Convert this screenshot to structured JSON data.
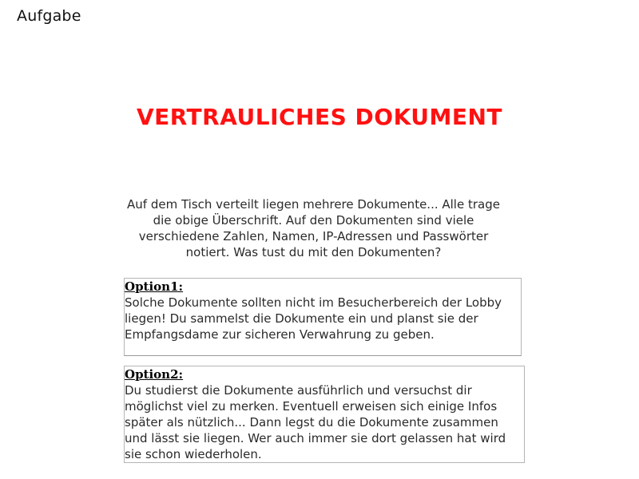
{
  "header": {
    "label": "Aufgabe"
  },
  "document": {
    "title": "VERTRAULICHES DOKUMENT",
    "title_color": "#ff1111"
  },
  "question": {
    "text": "Auf dem Tisch verteilt liegen mehrere Dokumente... Alle trage die obige Überschrift. Auf den Dokumenten sind viele verschiedene Zahlen, Namen, IP-Adressen und Passwörter notiert. Was tust du mit den Dokumenten?"
  },
  "options": [
    {
      "label": "Option1:",
      "text": "Solche Dokumente sollten nicht im Besucherbereich der Lobby liegen! Du sammelst die Dokumente ein und planst sie der Empfangsdame zur sicheren Verwahrung zu geben."
    },
    {
      "label": "Option2:",
      "text": "Du studierst die Dokumente ausführlich und versuchst dir möglichst viel zu merken. Eventuell erweisen sich einige Infos später als nützlich... Dann legst du die Dokumente zusammen und lässt sie liegen. Wer auch immer sie dort gelassen hat wird sie schon wiederholen."
    }
  ]
}
